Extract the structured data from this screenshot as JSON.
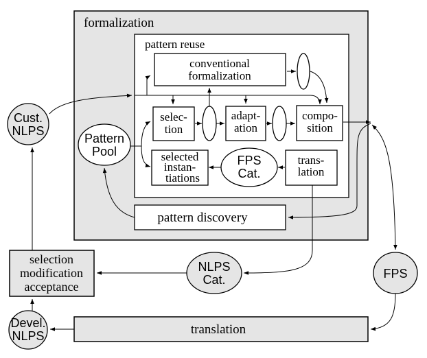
{
  "containers": {
    "formalization": "formalization",
    "pattern_reuse": "pattern reuse"
  },
  "boxes": {
    "conventional_formalization": [
      "conventional",
      "formalization"
    ],
    "selection": [
      "selec-",
      "tion"
    ],
    "adaptation": [
      "adapt-",
      "ation"
    ],
    "composition": [
      "compo-",
      "sition"
    ],
    "selected_instantiations": [
      "selected",
      "instan-",
      "tiations"
    ],
    "translation_inner": [
      "trans-",
      "lation"
    ],
    "pattern_discovery": "pattern discovery",
    "selection_modification_acceptance": [
      "selection",
      "modification",
      "acceptance"
    ],
    "translation_bottom": "translation"
  },
  "ellipses": {
    "pattern_pool": [
      "Pattern",
      "Pool"
    ],
    "fps_cat": [
      "FPS",
      "Cat."
    ],
    "cust_nlps": [
      "Cust.",
      "NLPS"
    ],
    "nlps_cat": [
      "NLPS",
      "Cat."
    ],
    "fps": "FPS",
    "devel_nlps": [
      "Devel.",
      "NLPS"
    ]
  },
  "colors": {
    "gray_fill": "#e5e5e5",
    "stroke": "#000000"
  }
}
